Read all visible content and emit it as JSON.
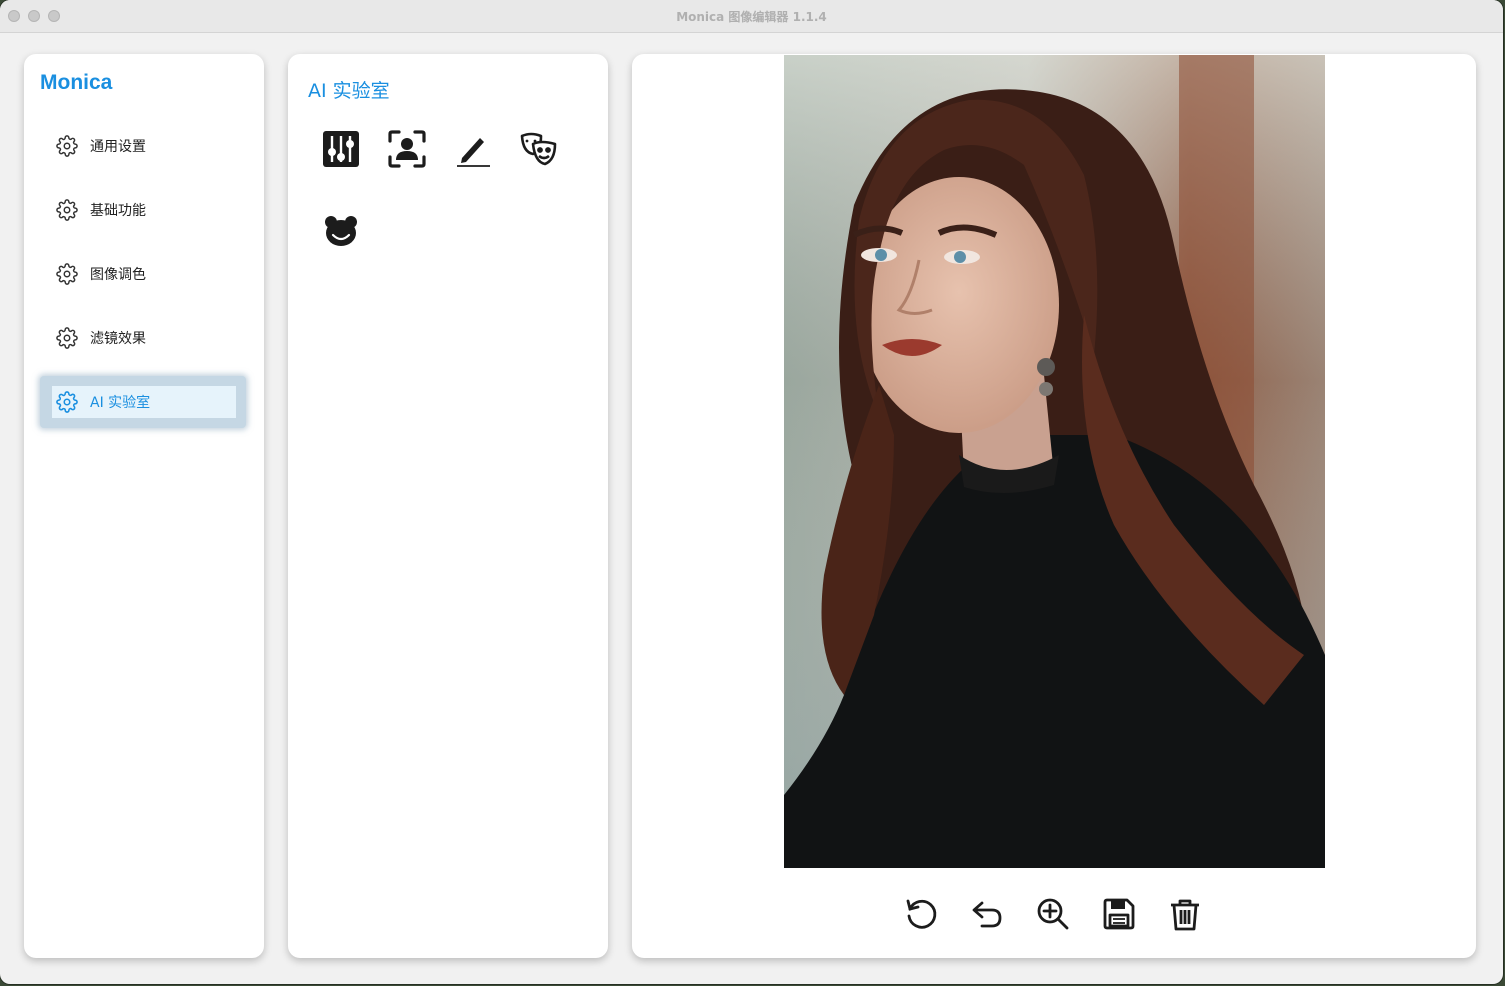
{
  "window": {
    "title": "Monica 图像编辑器 1.1.4"
  },
  "sidebar": {
    "brand": "Monica",
    "items": [
      {
        "label": "通用设置",
        "icon": "gear-icon",
        "active": false
      },
      {
        "label": "基础功能",
        "icon": "gear-icon",
        "active": false
      },
      {
        "label": "图像调色",
        "icon": "gear-icon",
        "active": false
      },
      {
        "label": "滤镜效果",
        "icon": "gear-icon",
        "active": false
      },
      {
        "label": "AI 实验室",
        "icon": "gear-icon",
        "active": true
      }
    ]
  },
  "tools": {
    "title": "AI 实验室",
    "buttons": [
      {
        "icon": "sliders-icon"
      },
      {
        "icon": "face-detect-icon"
      },
      {
        "icon": "pencil-icon"
      },
      {
        "icon": "theater-masks-icon"
      },
      {
        "icon": "bear-face-icon"
      }
    ]
  },
  "viewer": {
    "image": "portrait-photo",
    "actions": [
      {
        "icon": "rotate-icon"
      },
      {
        "icon": "undo-icon"
      },
      {
        "icon": "zoom-in-icon"
      },
      {
        "icon": "save-icon"
      },
      {
        "icon": "trash-icon"
      }
    ]
  },
  "colors": {
    "accent": "#1a8fe0",
    "active_bg": "#e6f3fb",
    "window_bg": "#f1f1f1"
  }
}
